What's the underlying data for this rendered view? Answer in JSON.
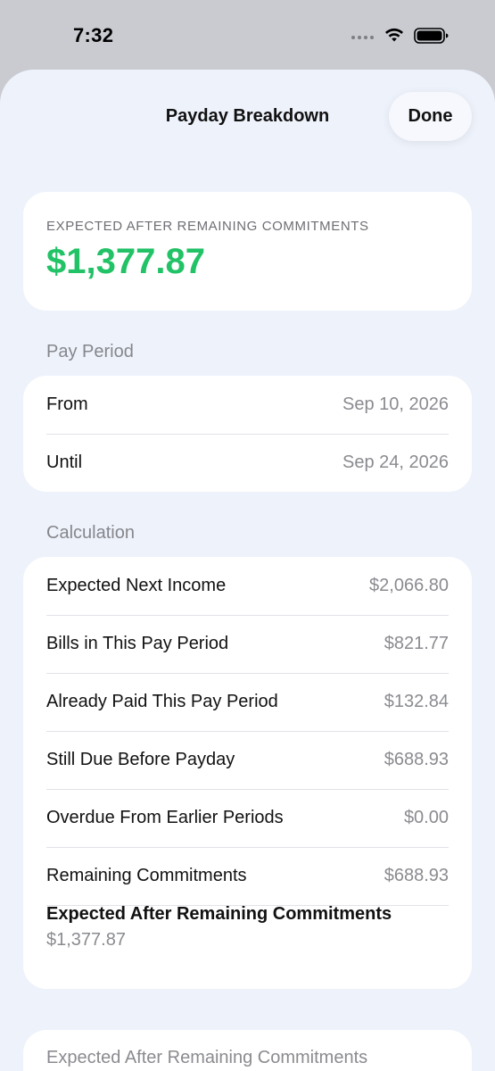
{
  "status_bar": {
    "time": "7:32"
  },
  "sheet": {
    "title": "Payday Breakdown",
    "done_label": "Done"
  },
  "summary": {
    "label": "EXPECTED AFTER REMAINING COMMITMENTS",
    "amount": "$1,377.87",
    "amount_color": "#22c267"
  },
  "pay_period": {
    "header": "Pay Period",
    "rows": [
      {
        "label": "From",
        "value": "Sep 10, 2026"
      },
      {
        "label": "Until",
        "value": "Sep 24, 2026"
      }
    ]
  },
  "calculation": {
    "header": "Calculation",
    "rows": [
      {
        "label": "Expected Next Income",
        "value": "$2,066.80"
      },
      {
        "label": "Bills in This Pay Period",
        "value": "$821.77"
      },
      {
        "label": "Already Paid This Pay Period",
        "value": "$132.84"
      },
      {
        "label": "Still Due Before Payday",
        "value": "$688.93"
      },
      {
        "label": "Overdue From Earlier Periods",
        "value": "$0.00"
      },
      {
        "label": "Remaining Commitments",
        "value": "$688.93"
      }
    ],
    "final_label": "Expected After Remaining Commitments",
    "final_value": "$1,377.87"
  },
  "bottom_card": {
    "label": "Expected After Remaining Commitments"
  },
  "icons": {
    "signal": "signal-dots-icon",
    "wifi": "wifi-icon",
    "battery": "battery-icon"
  }
}
